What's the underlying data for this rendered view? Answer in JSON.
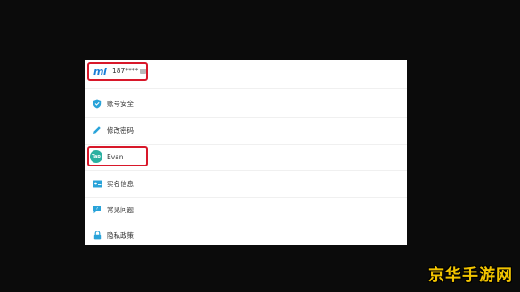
{
  "header": {
    "logo_text": "mi",
    "phone_masked": "187****"
  },
  "menu": [
    {
      "icon": "shield-check-icon",
      "label": "账号安全",
      "color": "#29a3d9"
    },
    {
      "icon": "pencil-icon",
      "label": "修改密码",
      "color": "#29a3d9"
    },
    {
      "icon": "avatar",
      "label": "Evan",
      "avatar_text": "Tap"
    },
    {
      "icon": "id-card-icon",
      "label": "实名信息",
      "color": "#29a3d9"
    },
    {
      "icon": "faq-chat-icon",
      "label": "常见问题",
      "color": "#29a3d9"
    },
    {
      "icon": "lock-icon",
      "label": "隐私政策",
      "color": "#29a3d9"
    }
  ],
  "highlight_color": "#d8182a",
  "watermark": {
    "text": "京华手游网"
  }
}
